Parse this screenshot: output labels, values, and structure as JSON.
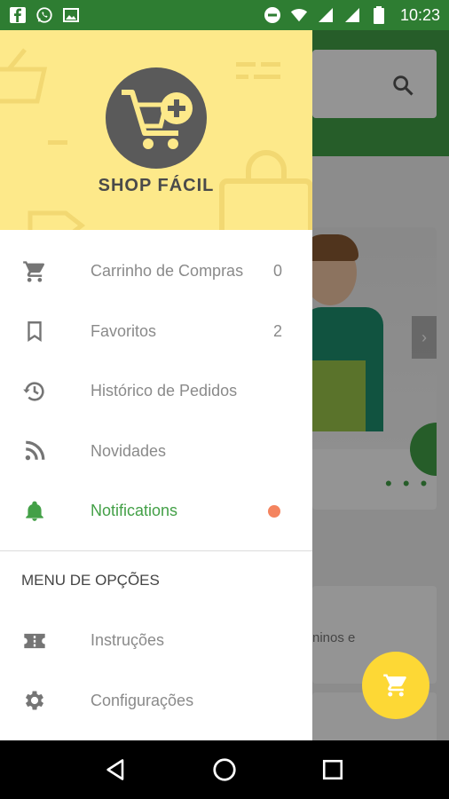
{
  "status_bar": {
    "time": "10:23",
    "left_icons": [
      "facebook-icon",
      "whatsapp-icon",
      "image-icon"
    ],
    "right_icons": [
      "do-not-disturb-icon",
      "wifi-icon",
      "signal-icon",
      "signal-icon",
      "battery-icon"
    ]
  },
  "colors": {
    "primary": "#43a047",
    "status_bar": "#2e7d32",
    "header_bg": "#fde98a",
    "logo_circle": "#5a5a5a",
    "fab": "#fdd835",
    "notification_dot": "#f4845f",
    "menu_text": "#8a8a8a"
  },
  "drawer": {
    "logo_text": "SHOP FÁCIL",
    "menu_items": [
      {
        "icon": "cart-icon",
        "label": "Carrinho de Compras",
        "count": "0"
      },
      {
        "icon": "bookmark-icon",
        "label": "Favoritos",
        "count": "2"
      },
      {
        "icon": "history-icon",
        "label": "Histórico de Pedidos",
        "count": ""
      },
      {
        "icon": "rss-icon",
        "label": "Novidades",
        "count": ""
      },
      {
        "icon": "bell-icon",
        "label": "Notifications",
        "count": "",
        "active": true,
        "has_dot": true
      }
    ],
    "options_section_title": "MENU DE OPÇÕES",
    "option_items": [
      {
        "icon": "ticket-icon",
        "label": "Instruções"
      },
      {
        "icon": "gear-icon",
        "label": "Configurações"
      }
    ]
  },
  "background": {
    "card_text": "ninos e"
  },
  "nav_bar": {
    "buttons": [
      "back-icon",
      "home-icon",
      "recents-icon"
    ]
  }
}
